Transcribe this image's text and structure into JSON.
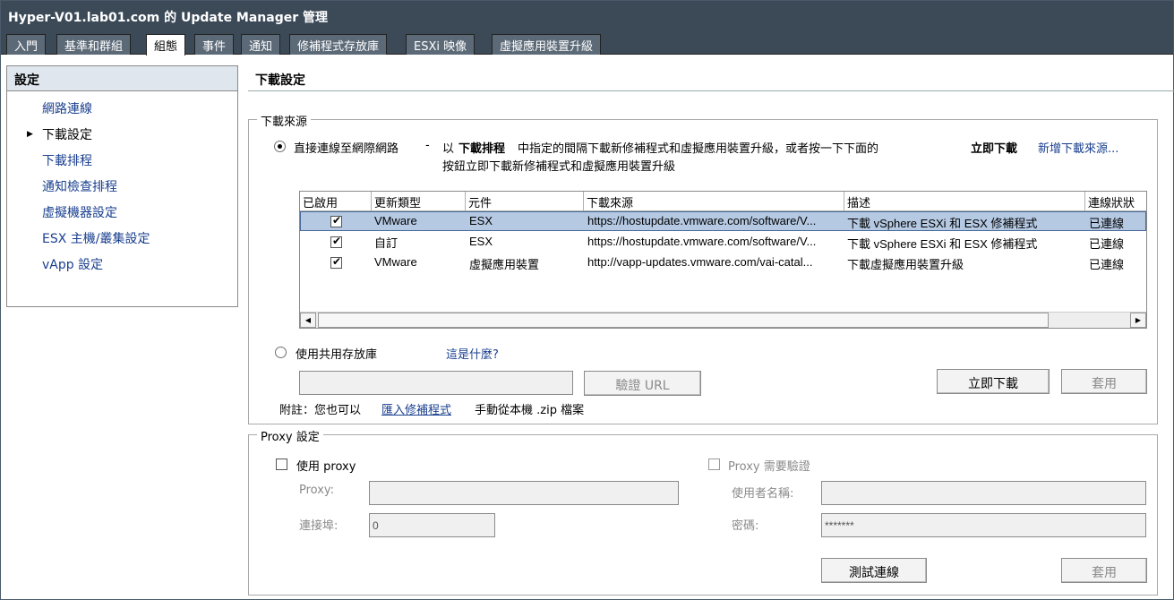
{
  "window": {
    "title": "Hyper-V01.lab01.com 的 Update Manager 管理"
  },
  "tabs": [
    {
      "label": "入門",
      "active": false
    },
    {
      "label": "基準和群組",
      "active": false
    },
    {
      "label": "組態",
      "active": true
    },
    {
      "label": "事件",
      "active": false
    },
    {
      "label": "通知",
      "active": false
    },
    {
      "label": "修補程式存放庫",
      "active": false
    },
    {
      "label": "ESXi 映像",
      "active": false
    },
    {
      "label": "虛擬應用裝置升級",
      "active": false
    }
  ],
  "sidebar": {
    "header": "設定",
    "items": [
      {
        "label": "網路連線",
        "current": false
      },
      {
        "label": "下載設定",
        "current": true
      },
      {
        "label": "下載排程",
        "current": false
      },
      {
        "label": "通知檢查排程",
        "current": false
      },
      {
        "label": "虛擬機器設定",
        "current": false
      },
      {
        "label": "ESX 主機/叢集設定",
        "current": false
      },
      {
        "label": "vApp 設定",
        "current": false
      }
    ]
  },
  "main": {
    "title": "下載設定",
    "download_sources": {
      "legend": "下載來源",
      "direct_option": {
        "label": "直接連線至網際網路",
        "selected": true,
        "desc_dash": "-",
        "desc_part1": "以",
        "desc_bold1": "下載排程",
        "desc_part2": "中指定的間隔下載新修補程式和虛擬應用裝置升級，或者按一下下面的",
        "desc_bold2": "立即下載",
        "desc_line2": "按鈕立即下載新修補程式和虛擬應用裝置升級",
        "add_source_link": "新增下載來源..."
      },
      "table": {
        "columns": [
          "已啟用",
          "更新類型",
          "元件",
          "下載來源",
          "描述",
          "連線狀狀"
        ],
        "rows": [
          {
            "enabled": true,
            "type": "VMware",
            "component": "ESX",
            "source": "https://hostupdate.vmware.com/software/V...",
            "description": "下載 vSphere ESXi 和 ESX 修補程式",
            "status": "已連線",
            "selected": true
          },
          {
            "enabled": true,
            "type": "自訂",
            "component": "ESX",
            "source": "https://hostupdate.vmware.com/software/V...",
            "description": "下載 vSphere ESXi 和 ESX 修補程式",
            "status": "已連線",
            "selected": false
          },
          {
            "enabled": true,
            "type": "VMware",
            "component": "虛擬應用裝置",
            "source": "http://vapp-updates.vmware.com/vai-catal...",
            "description": "下載虛擬應用裝置升級",
            "status": "已連線",
            "selected": false
          }
        ],
        "scroll_left": "◀",
        "scroll_right": "▶"
      },
      "shared_repo_option": {
        "label": "使用共用存放庫",
        "selected": false,
        "help_link": "這是什麼?"
      },
      "repo_url_value": "",
      "validate_button": "驗證 URL",
      "download_now_button": "立即下載",
      "apply_button": "套用",
      "note_prefix": "附註：您也可以",
      "note_link": "匯入修補程式",
      "note_suffix": "手動從本機 .zip 檔案"
    },
    "proxy": {
      "legend": "Proxy 設定",
      "use_proxy_label": "使用 proxy",
      "use_proxy_checked": false,
      "proxy_label": "Proxy:",
      "proxy_value": "",
      "port_label": "連接埠:",
      "port_value": "0",
      "auth_label": "Proxy 需要驗證",
      "auth_checked": false,
      "username_label": "使用者名稱:",
      "username_value": "",
      "password_label": "密碼:",
      "password_value": "*******",
      "test_button": "測試連線",
      "apply_button": "套用"
    }
  }
}
